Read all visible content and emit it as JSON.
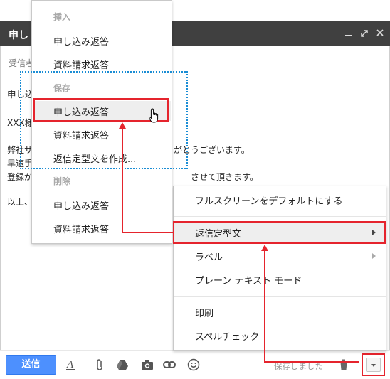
{
  "compose": {
    "title": "申し",
    "to_label": "受信者",
    "subject": "申し込",
    "body_lines": [
      "XXX様",
      "弊社サ",
      "早速手",
      "登録が",
      "以上、"
    ],
    "body_tail": [
      "がとうございます。",
      "させて頂きます。"
    ]
  },
  "template_menu": {
    "insert_header": "挿入",
    "insert_items": [
      "申し込み返答",
      "資料請求返答"
    ],
    "save_header": "保存",
    "save_items": [
      "申し込み返答",
      "資料請求返答",
      "返信定型文を作成..."
    ],
    "delete_header": "削除",
    "delete_items": [
      "申し込み返答",
      "資料請求返答"
    ]
  },
  "more_menu": {
    "fullscreen_default": "フルスクリーンをデフォルトにする",
    "canned_responses": "返信定型文",
    "labels": "ラベル",
    "plain_text_mode": "プレーン テキスト モード",
    "print": "印刷",
    "spellcheck": "スペルチェック"
  },
  "toolbar": {
    "send_label": "送信",
    "saved_status": "保存しました"
  },
  "colors": {
    "send_blue": "#4d90fe",
    "annotation_red": "#e5242d",
    "dotted_blue": "#1a8dd4",
    "titlebar": "#404040"
  },
  "icons": [
    "text-format-icon",
    "attach-icon",
    "drive-icon",
    "camera-icon",
    "link-icon",
    "emoji-icon",
    "trash-icon",
    "caret-down-icon",
    "minimize-icon",
    "expand-icon",
    "close-icon",
    "hand-pointer-icon"
  ]
}
